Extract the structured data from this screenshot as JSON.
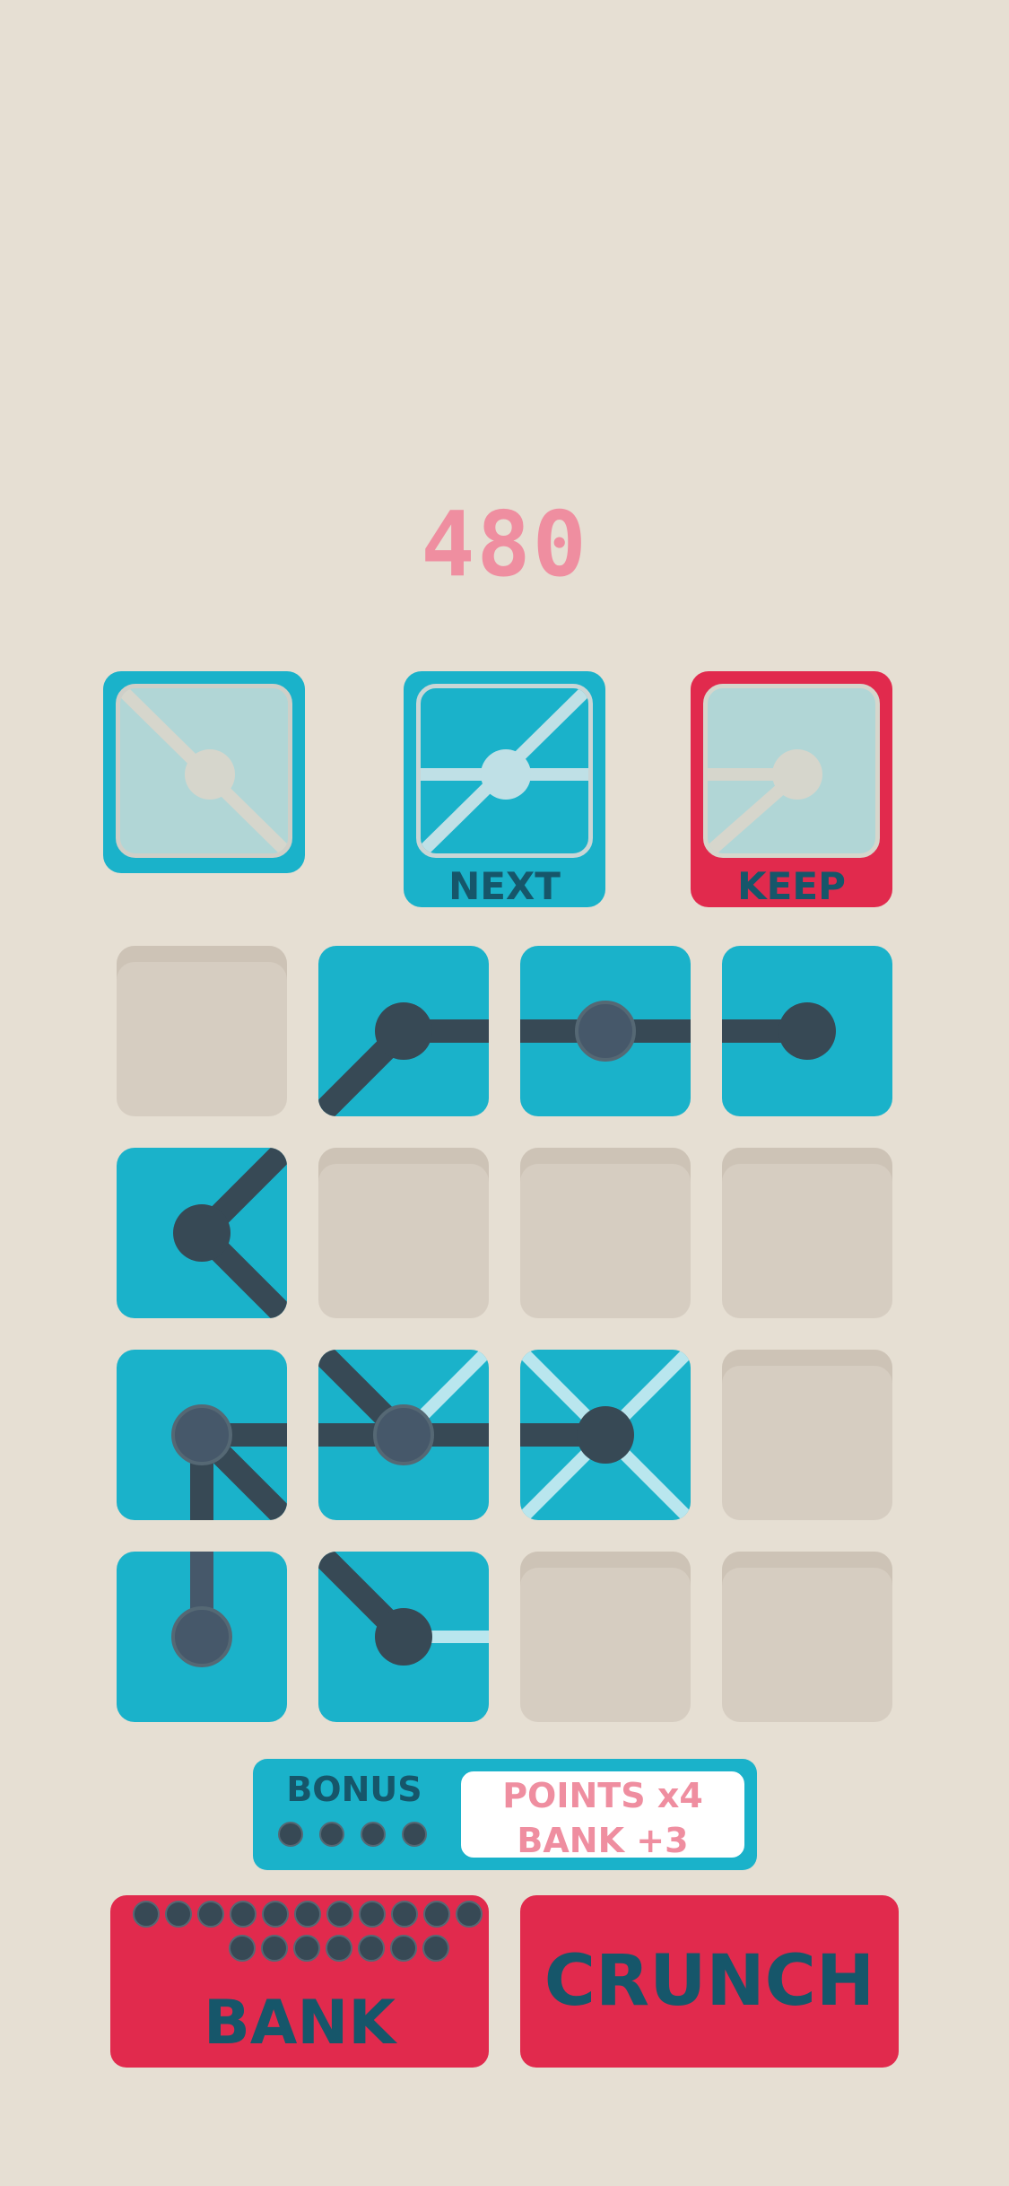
{
  "score": "480",
  "cards": {
    "next_label": "NEXT",
    "keep_label": "KEEP"
  },
  "bonus": {
    "label": "BONUS",
    "reward_line1": "POINTS x4",
    "reward_line2": "BANK +3",
    "dots": 4
  },
  "buttons": {
    "bank_label": "BANK",
    "crunch_label": "CRUNCH"
  },
  "colors": {
    "background": "#e6dfd3",
    "tile": "#1ab2ca",
    "red": "#e12a4d",
    "score": "#ef8ea0",
    "pipe": "#374955",
    "empty": "#d6cdc1"
  },
  "grid": {
    "rows": 4,
    "cols": 4,
    "cells": [
      "empty",
      "filled",
      "filled",
      "filled",
      "filled",
      "empty",
      "empty",
      "empty",
      "filled",
      "filled",
      "filled",
      "empty",
      "filled",
      "filled",
      "empty",
      "empty"
    ]
  }
}
